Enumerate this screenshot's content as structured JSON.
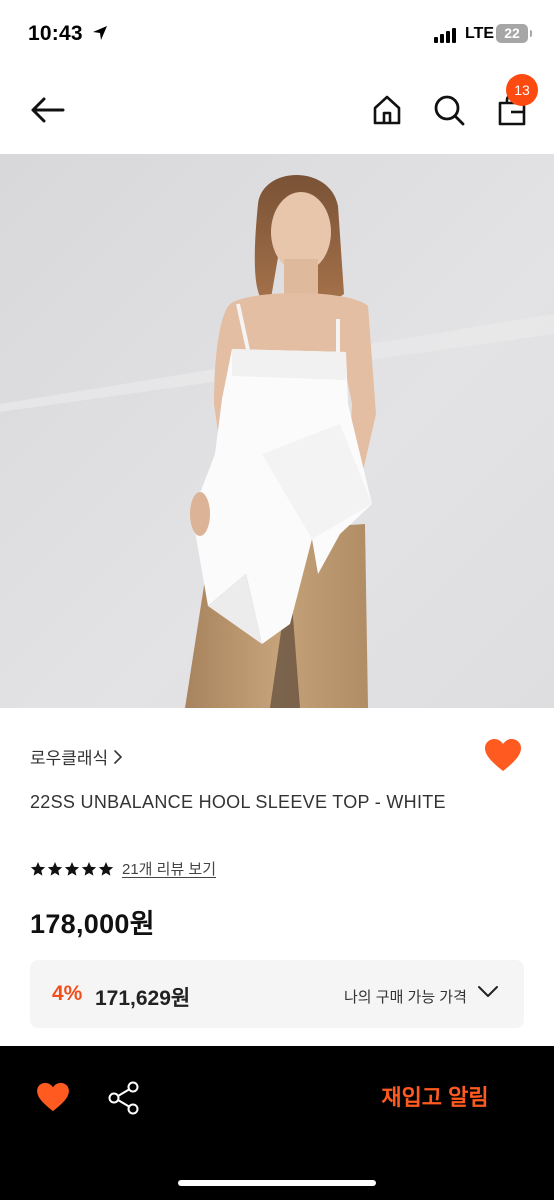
{
  "status_bar": {
    "time": "10:43",
    "network": "LTE",
    "battery": "22"
  },
  "nav": {
    "cart_count": "13"
  },
  "product": {
    "brand": "로우클래식",
    "name": "22SS UNBALANCE HOOL SLEEVE TOP - WHITE",
    "rating_stars": 5,
    "review_link": "21개 리뷰 보기",
    "price": "178,000원"
  },
  "my_price": {
    "discount_rate": "4%",
    "price": "171,629원",
    "label": "나의 구매 가능 가격"
  },
  "bottom_bar": {
    "restock_label": "재입고 알림"
  },
  "colors": {
    "accent": "#FF5A1F",
    "badge": "#FC4A10",
    "discount": "#F04E1B",
    "bottom_bar_bg": "#000000"
  },
  "icons": [
    "location-arrow-icon",
    "signal-icon",
    "battery-icon",
    "back-arrow-icon",
    "home-icon",
    "search-icon",
    "shopping-bag-icon",
    "chevron-right-icon",
    "heart-icon",
    "star-icon",
    "chevron-down-icon",
    "share-icon"
  ]
}
